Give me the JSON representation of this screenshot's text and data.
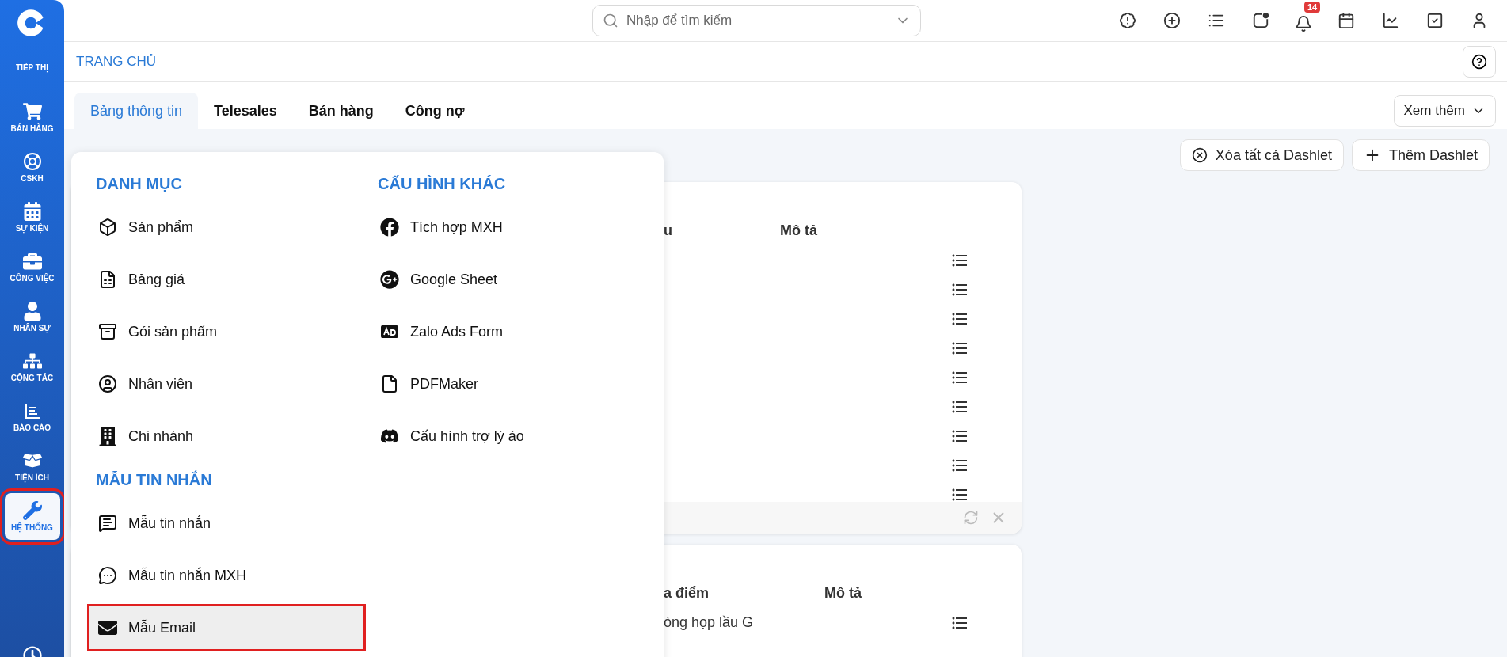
{
  "sidebar": {
    "items": [
      {
        "label": "TIẾP THỊ",
        "selected": false,
        "highlighted": false
      },
      {
        "label": "BÁN HÀNG",
        "selected": false,
        "highlighted": false
      },
      {
        "label": "CSKH",
        "selected": false,
        "highlighted": false
      },
      {
        "label": "SỰ KIỆN",
        "selected": false,
        "highlighted": false
      },
      {
        "label": "CÔNG VIỆC",
        "selected": false,
        "highlighted": false
      },
      {
        "label": "NHÂN SỰ",
        "selected": false,
        "highlighted": false
      },
      {
        "label": "CỘNG TÁC",
        "selected": false,
        "highlighted": false
      },
      {
        "label": "BÁO CÁO",
        "selected": false,
        "highlighted": false
      },
      {
        "label": "TIỆN ÍCH",
        "selected": false,
        "highlighted": false
      },
      {
        "label": "HỆ THỐNG",
        "selected": true,
        "highlighted": true
      }
    ]
  },
  "search": {
    "placeholder": "Nhập để tìm kiếm"
  },
  "notification_badge": "14",
  "page_title": "TRANG CHỦ",
  "tabs": [
    {
      "label": "Bảng thông tin",
      "selected": true
    },
    {
      "label": "Telesales",
      "selected": false
    },
    {
      "label": "Bán hàng",
      "selected": false
    },
    {
      "label": "Công nợ",
      "selected": false
    }
  ],
  "more_button": "Xem thêm",
  "dashlet_actions": [
    "Xóa tất cả Dashlet",
    "Thêm Dashlet"
  ],
  "dashlets": [
    {
      "columns": [
        "u",
        "Mô tả"
      ],
      "rows": [
        {
          "kind": "row"
        },
        {
          "kind": "row"
        },
        {
          "kind": "row"
        },
        {
          "kind": "row"
        },
        {
          "kind": "row"
        },
        {
          "kind": "row"
        },
        {
          "kind": "row"
        },
        {
          "kind": "row"
        },
        {
          "kind": "row"
        }
      ]
    },
    {
      "columns": [
        "a điểm",
        "Mô tả"
      ],
      "rows": [
        {
          "kind": "row",
          "cells": [
            "òng họp lầu G"
          ]
        }
      ]
    }
  ],
  "menu": {
    "columns": [
      {
        "sections": [
          {
            "title": "DANH MỤC",
            "items": [
              {
                "label": "Sản phẩm",
                "selected": false,
                "highlighted": false
              },
              {
                "label": "Bảng giá",
                "selected": false,
                "highlighted": false
              },
              {
                "label": "Gói sản phẩm",
                "selected": false,
                "highlighted": false
              },
              {
                "label": "Nhân viên",
                "selected": false,
                "highlighted": false
              },
              {
                "label": "Chi nhánh",
                "selected": false,
                "highlighted": false
              }
            ]
          },
          {
            "title": "MẪU TIN NHẮN",
            "items": [
              {
                "label": "Mẫu tin nhắn",
                "selected": false,
                "highlighted": false
              },
              {
                "label": "Mẫu tin nhắn MXH",
                "selected": false,
                "highlighted": false
              },
              {
                "label": "Mẫu Email",
                "selected": true,
                "highlighted": true
              }
            ]
          }
        ]
      },
      {
        "sections": [
          {
            "title": "CẤU HÌNH KHÁC",
            "items": [
              {
                "label": "Tích hợp MXH",
                "selected": false,
                "highlighted": false
              },
              {
                "label": "Google Sheet",
                "selected": false,
                "highlighted": false
              },
              {
                "label": "Zalo Ads Form",
                "selected": false,
                "highlighted": false
              },
              {
                "label": "PDFMaker",
                "selected": false,
                "highlighted": false
              },
              {
                "label": "Cấu hình trợ lý ảo",
                "selected": false,
                "highlighted": false
              }
            ]
          }
        ]
      }
    ]
  }
}
